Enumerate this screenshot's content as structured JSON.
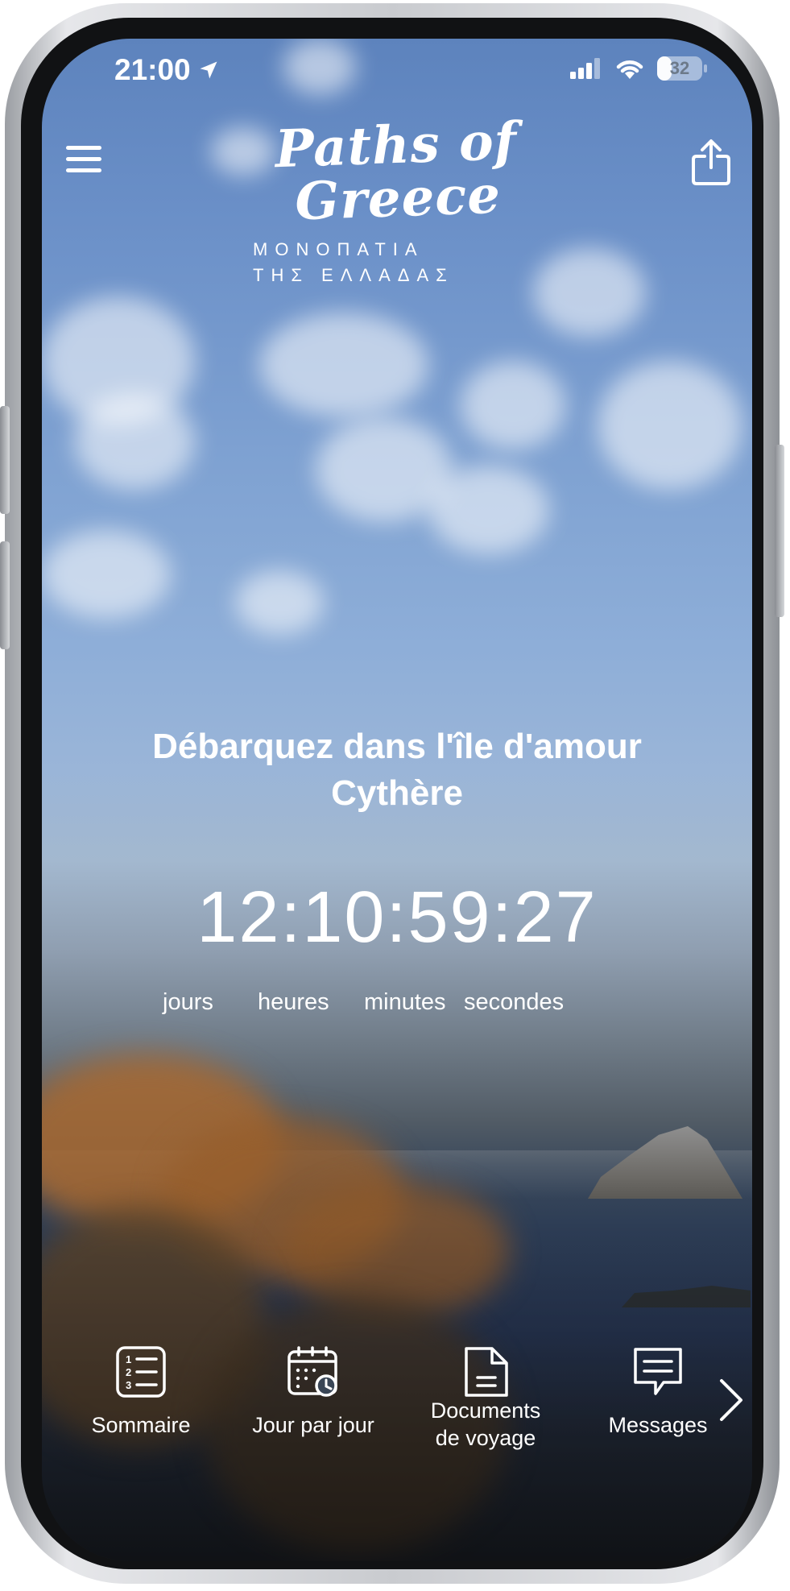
{
  "status_bar": {
    "time": "21:00",
    "battery": "32",
    "battery_level": 0.32
  },
  "header": {
    "logo_title_line1": "Paths of",
    "logo_title_line2": "Greece",
    "logo_subtitle_line1": "ΜΟΝΟΠΑΤΙΑ",
    "logo_subtitle_line2": "ΤΗΣ ΕΛΛΑΔΑΣ"
  },
  "hero": {
    "headline_line1": "Débarquez dans l'île d'amour",
    "headline_line2": "Cythère",
    "countdown": {
      "value": "12:10:59:27",
      "labels": [
        "jours",
        "heures",
        "minutes",
        "secondes"
      ]
    }
  },
  "bottom_nav": {
    "items": [
      {
        "label": "Sommaire",
        "icon": "numbered-list-icon"
      },
      {
        "label": "Jour par jour",
        "icon": "calendar-clock-icon"
      },
      {
        "label": "Documents\nde voyage",
        "icon": "document-icon"
      },
      {
        "label": "Messages",
        "icon": "message-bubble-icon"
      }
    ],
    "more_icon": "chevron-right-icon"
  }
}
